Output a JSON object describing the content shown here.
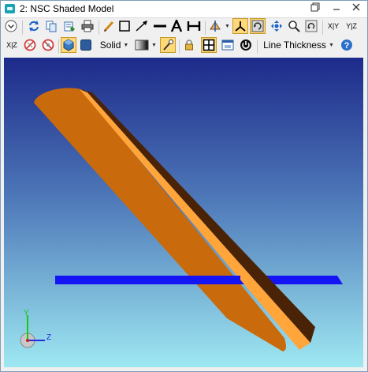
{
  "window": {
    "title": "2: NSC Shaded Model"
  },
  "toolbar": {
    "xy_label": "X|Y",
    "yz_label": "Y|Z",
    "xz_label": "X|Z",
    "render_mode": "Solid",
    "line_thickness": "Line Thickness"
  },
  "axes": {
    "y": "Y",
    "z": "Z"
  },
  "colors": {
    "background_top": "#1d2a8a",
    "background_bottom": "#9ee8f2",
    "object_front": "#c96a0c",
    "object_edge": "#ffa53a",
    "object_side": "#4a2306",
    "detector": "#1414f5",
    "active_button": "#ffd978"
  },
  "icons": [
    "chevron-down-icon",
    "refresh-icon",
    "copy-icon",
    "save-icon",
    "print-icon",
    "pencil-icon",
    "rectangle-icon",
    "arrow-icon",
    "line-icon",
    "text-icon",
    "dimension-icon",
    "ray-icon",
    "axes-icon",
    "rotate-icon",
    "pan-icon",
    "zoom-icon",
    "reset-view-icon",
    "no-rays-icon",
    "hide-icon",
    "shaded-mode-icon",
    "solid-mode-icon",
    "gradient-icon",
    "lighting-icon",
    "lock-icon",
    "frame-icon",
    "window-icon",
    "power-icon",
    "help-icon"
  ]
}
